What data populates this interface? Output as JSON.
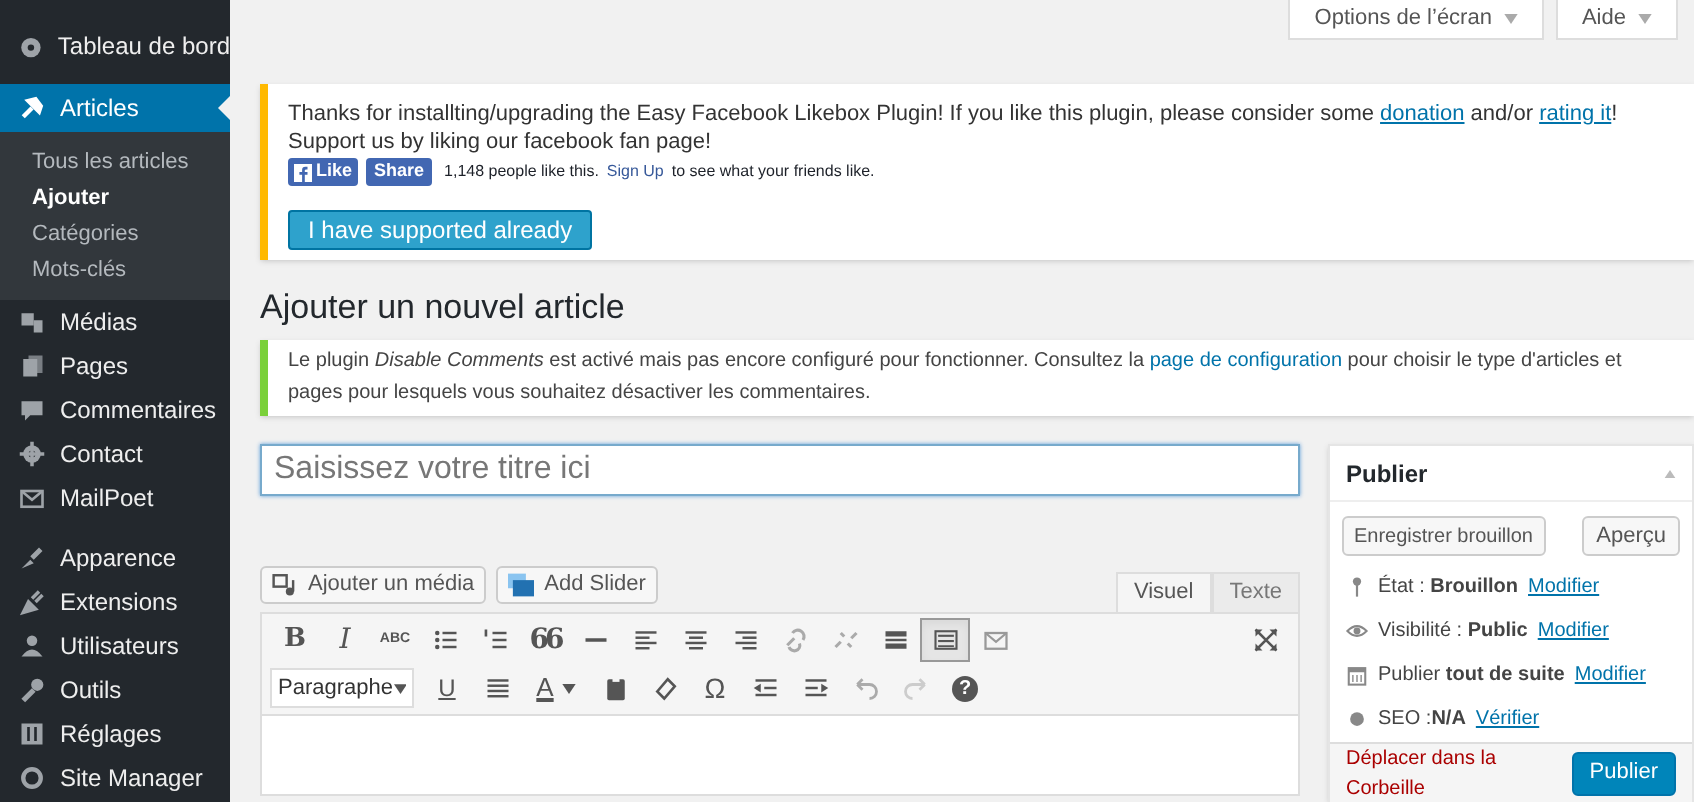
{
  "sidebar": {
    "items": [
      {
        "label": "Tableau de bord",
        "selected": false
      },
      {
        "label": "Articles",
        "selected": true,
        "children": [
          {
            "label": "Tous les articles",
            "selected": false
          },
          {
            "label": "Ajouter",
            "selected": true
          },
          {
            "label": "Catégories",
            "selected": false
          },
          {
            "label": "Mots-clés",
            "selected": false
          }
        ]
      },
      {
        "label": "Médias",
        "selected": false
      },
      {
        "label": "Pages",
        "selected": false
      },
      {
        "label": "Commentaires",
        "selected": false
      },
      {
        "label": "Contact",
        "selected": false
      },
      {
        "label": "MailPoet",
        "selected": false
      },
      {
        "label": "Apparence",
        "selected": false
      },
      {
        "label": "Extensions",
        "selected": false
      },
      {
        "label": "Utilisateurs",
        "selected": false
      },
      {
        "label": "Outils",
        "selected": false
      },
      {
        "label": "Réglages",
        "selected": false
      },
      {
        "label": "Site Manager",
        "selected": false
      }
    ]
  },
  "screen_tabs": [
    "Options de l’écran",
    "Aide"
  ],
  "facebook_notice": {
    "segments": [
      {
        "text": "Thanks for installting/upgrading the Easy Facebook Likebox Plugin! If you like this plugin, please consider some ",
        "link": false
      },
      {
        "text": "donation",
        "link": true
      },
      {
        "text": " and/or ",
        "link": false
      },
      {
        "text": "rating it",
        "link": true
      },
      {
        "text": "! Support us by liking our facebook fan page!",
        "link": false
      }
    ],
    "like_button": "Like",
    "share_button": "Share",
    "like_count": "1,148 people like this.",
    "signup_link": "Sign Up",
    "signup_text": "to see what your friends like.",
    "button": "I have supported already"
  },
  "heading": "Ajouter un nouvel article",
  "comments_notice": {
    "segments": [
      {
        "text": "Le plugin *Disable Comments* est activé mais pas encore configuré pour fonctionner. Consultez la ",
        "link": false
      },
      {
        "text": "page de configuration",
        "link": true
      },
      {
        "text": " pour choisir le type d'articles et pages pour lesquels vous souhaitez désactiver les commentaires.",
        "link": false
      }
    ]
  },
  "title_field": {
    "placeholder": "Saisissez votre titre ici"
  },
  "media_buttons": [
    "Ajouter un média",
    "Add Slider"
  ],
  "editor_tabs": [
    {
      "label": "Visuel",
      "selected": true
    },
    {
      "label": "Texte",
      "selected": false
    }
  ],
  "toolbar": {
    "row_1": [
      {
        "kind": "bold",
        "text": "B",
        "on": false
      },
      {
        "kind": "italic",
        "text": "I",
        "on": false
      },
      {
        "kind": "strike",
        "text": "ABC",
        "on": false
      },
      {
        "kind": "bullets",
        "on": false
      },
      {
        "kind": "numbers",
        "on": false
      },
      {
        "kind": "quote",
        "text": "66",
        "on": false
      },
      {
        "kind": "rule",
        "on": false
      },
      {
        "kind": "alignleft",
        "on": false
      },
      {
        "kind": "aligncenter",
        "on": false
      },
      {
        "kind": "alignright",
        "on": false
      },
      {
        "kind": "link",
        "on": false
      },
      {
        "kind": "unlink",
        "on": false
      },
      {
        "kind": "more",
        "on": false
      },
      {
        "kind": "kitchensink",
        "on": true
      },
      {
        "kind": "mail",
        "on": false
      }
    ],
    "row_2": [
      {
        "kind": "underline",
        "text": "U",
        "on": false
      },
      {
        "kind": "justify",
        "on": false
      },
      {
        "kind": "color",
        "text": "A",
        "on": false
      },
      {
        "kind": "paste",
        "on": false
      },
      {
        "kind": "eraser",
        "on": false
      },
      {
        "kind": "omega",
        "text": "Ω",
        "on": false
      },
      {
        "kind": "outdent",
        "on": false
      },
      {
        "kind": "indent",
        "on": false
      },
      {
        "kind": "undo",
        "on": false
      },
      {
        "kind": "redo",
        "on": false
      },
      {
        "kind": "help",
        "text": "?",
        "on": false
      }
    ],
    "format_select": "Paragraphe"
  },
  "publish_box": {
    "title": "Publier",
    "draft_button": "Enregistrer brouillon",
    "preview_button": "Aperçu",
    "rows": [
      {
        "kind": "pin",
        "text": "État : **Brouillon**",
        "link": "Modifier"
      },
      {
        "kind": "eye",
        "text": "Visibilité : **Public**",
        "link": "Modifier"
      },
      {
        "kind": "calendar",
        "text": "Publier **tout de suite**",
        "link": "Modifier"
      },
      {
        "kind": "dot",
        "text": "SEO :**N/A**",
        "link": "Vérifier"
      }
    ],
    "trash_link": "Déplacer dans la Corbeille",
    "publish_button": "Publier"
  }
}
